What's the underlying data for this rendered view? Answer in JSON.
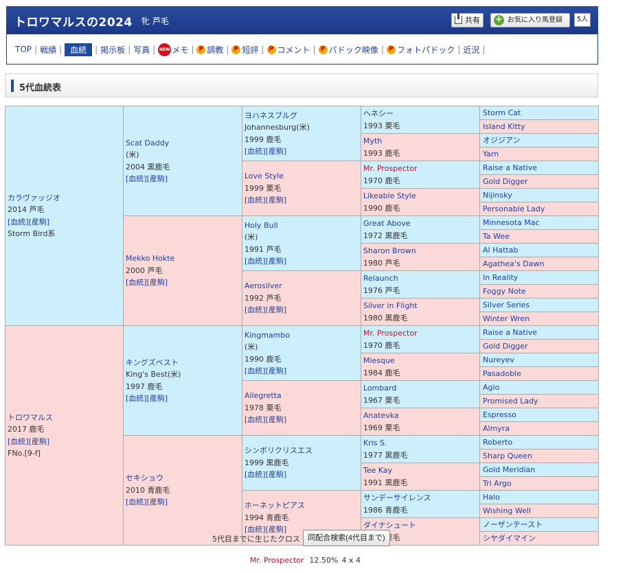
{
  "header": {
    "title": "トロワマルスの2024",
    "sub_info": "牝 芦毛",
    "share_label": "共有",
    "favorite_label": "お気に入り馬登録",
    "favorite_count": "5人"
  },
  "nav": {
    "items": [
      {
        "label": "TOP"
      },
      {
        "label": "戦績"
      },
      {
        "label": "血統",
        "active": true
      },
      {
        "label": "掲示板"
      },
      {
        "label": "写真"
      },
      {
        "label": "メモ",
        "badge": "NEW"
      },
      {
        "label": "調教",
        "premium": true
      },
      {
        "label": "短評",
        "premium": true
      },
      {
        "label": "コメント",
        "premium": true
      },
      {
        "label": "パドック映像",
        "premium": true
      },
      {
        "label": "フォトパドック",
        "premium": true
      },
      {
        "label": "近況"
      }
    ],
    "premium_mark": "P"
  },
  "section": {
    "title": "5代血統表"
  },
  "pedigree": {
    "links": {
      "pedigree": "[血統]",
      "foals": "[産駒]"
    },
    "gen1": [
      {
        "name": "カラヴァッジオ",
        "info": "2014 芦毛",
        "extra": "Storm Bird系",
        "sex": "m"
      },
      {
        "name": "トロワマルス",
        "info": "2017 鹿毛",
        "extra": "FNo.[9-f]",
        "sex": "f"
      }
    ],
    "gen2": [
      {
        "name": "Scat Daddy",
        "country": "(米)",
        "info": "2004 黒鹿毛",
        "sex": "m"
      },
      {
        "name": "Mekko Hokte",
        "info": "2000 芦毛",
        "sex": "f"
      },
      {
        "name": "キングズベスト",
        "name2": "King's Best(米)",
        "info": "1997 鹿毛",
        "sex": "m"
      },
      {
        "name": "セキショウ",
        "info": "2010 青鹿毛",
        "sex": "f"
      }
    ],
    "gen3": [
      {
        "name": "ヨハネスブルグ",
        "name2": "Johannesburg(米)",
        "info": "1999 鹿毛",
        "sex": "m"
      },
      {
        "name": "Love Style",
        "info": "1999 栗毛",
        "sex": "f"
      },
      {
        "name": "Holy Bull",
        "country": "(米)",
        "info": "1991 芦毛",
        "sex": "m"
      },
      {
        "name": "Aerosilver",
        "info": "1992 芦毛",
        "sex": "f"
      },
      {
        "name": "Kingmambo",
        "country": "(米)",
        "info": "1990 鹿毛",
        "sex": "m"
      },
      {
        "name": "Allegretta",
        "info": "1978 栗毛",
        "sex": "f"
      },
      {
        "name": "シンボリクリスエス",
        "info": "1999 黒鹿毛",
        "sex": "m"
      },
      {
        "name": "ホーネットピアス",
        "info": "1994 青鹿毛",
        "sex": "f"
      }
    ],
    "gen4": [
      {
        "name": "ヘネシー",
        "info": "1993 栗毛",
        "sex": "m"
      },
      {
        "name": "Myth",
        "info": "1993 鹿毛",
        "sex": "f"
      },
      {
        "name": "Mr. Prospector",
        "info": "1970 鹿毛",
        "sex": "m",
        "cross": true
      },
      {
        "name": "Likeable Style",
        "info": "1990 鹿毛",
        "sex": "f"
      },
      {
        "name": "Great Above",
        "info": "1972 黒鹿毛",
        "sex": "m"
      },
      {
        "name": "Sharon Brown",
        "info": "1980 芦毛",
        "sex": "f"
      },
      {
        "name": "Relaunch",
        "info": "1976 芦毛",
        "sex": "m"
      },
      {
        "name": "Silver in Flight",
        "info": "1980 黒鹿毛",
        "sex": "f"
      },
      {
        "name": "Mr. Prospector",
        "info": "1970 鹿毛",
        "sex": "m",
        "cross": true
      },
      {
        "name": "Miesque",
        "info": "1984 鹿毛",
        "sex": "f"
      },
      {
        "name": "Lombard",
        "info": "1967 栗毛",
        "sex": "m"
      },
      {
        "name": "Anatevka",
        "info": "1969 栗毛",
        "sex": "f"
      },
      {
        "name": "Kris S.",
        "info": "1977 黒鹿毛",
        "sex": "m"
      },
      {
        "name": "Tee Kay",
        "info": "1991 黒鹿毛",
        "sex": "f"
      },
      {
        "name": "サンデーサイレンス",
        "info": "1986 青鹿毛",
        "sex": "m"
      },
      {
        "name": "ダイナシュート",
        "info": "1982 栗毛",
        "sex": "f"
      }
    ],
    "gen5": [
      "Storm Cat",
      "Island Kitty",
      "オジジアン",
      "Yarn",
      "Raise a Native",
      "Gold Digger",
      "Nijinsky",
      "Personable Lady",
      "Minnesota Mac",
      "Ta Wee",
      "Al Hattab",
      "Agathea's Dawn",
      "In Reality",
      "Foggy Note",
      "Silver Series",
      "Winter Wren",
      "Raise a Native",
      "Gold Digger",
      "Nureyev",
      "Pasadoble",
      "Agio",
      "Promised Lady",
      "Espresso",
      "Almyra",
      "Roberto",
      "Sharp Queen",
      "Gold Meridian",
      "Tri Argo",
      "Halo",
      "Wishing Well",
      "ノーザンテースト",
      "シヤダイマイン"
    ]
  },
  "cross": {
    "label": "5代目までに生じたクロス",
    "button_label": "同配合検索(4代目まで)",
    "results": [
      {
        "name": "Mr. Prospector",
        "percent": "12.50%",
        "pattern": "4 x 4"
      }
    ]
  }
}
